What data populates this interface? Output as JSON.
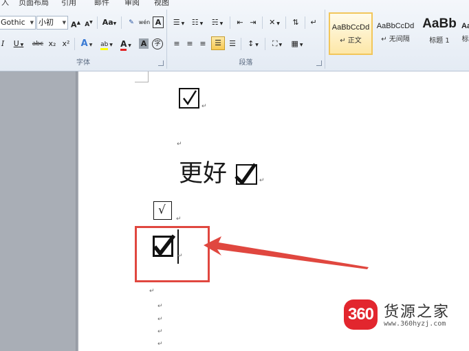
{
  "ribbon": {
    "tabs": [
      "入",
      "页面布局",
      "引用",
      "邮件",
      "审阅",
      "视图"
    ],
    "font_group": {
      "label": "字体",
      "font_name": "Gothic",
      "font_size": "小初",
      "grow_font": "A",
      "shrink_font": "A",
      "change_case": "Aa",
      "phonetic": "wén",
      "char_border": "A",
      "italic": "I",
      "underline": "U",
      "strikethrough": "abc",
      "subscript": "x₂",
      "superscript": "x²",
      "text_effect": "A",
      "highlight": "ab",
      "font_color": "A",
      "char_shading": "A",
      "enclose": "字"
    },
    "paragraph_group": {
      "label": "段落"
    },
    "styles": [
      {
        "sample": "AaBbCcDd",
        "name": "↵ 正文"
      },
      {
        "sample": "AaBbCcDd",
        "name": "↵ 无间隔"
      },
      {
        "sample": "AaBb",
        "name": "标题 1"
      },
      {
        "sample": "Aa",
        "name": "标"
      }
    ],
    "colors": {
      "highlight": "#ffff00",
      "font_color": "#e02020",
      "selected_style": "#f2c65a"
    }
  },
  "document": {
    "text_line": "更好",
    "paragraph_mark": "↵",
    "checkbox_symbol": "☑",
    "plain_check_symbol": "√"
  },
  "annotation": {
    "color": "#e0473f"
  },
  "watermark": {
    "badge": "360",
    "title": "货源之家",
    "url": "www.360hyzj.com",
    "badge_color": "#e2262e"
  }
}
